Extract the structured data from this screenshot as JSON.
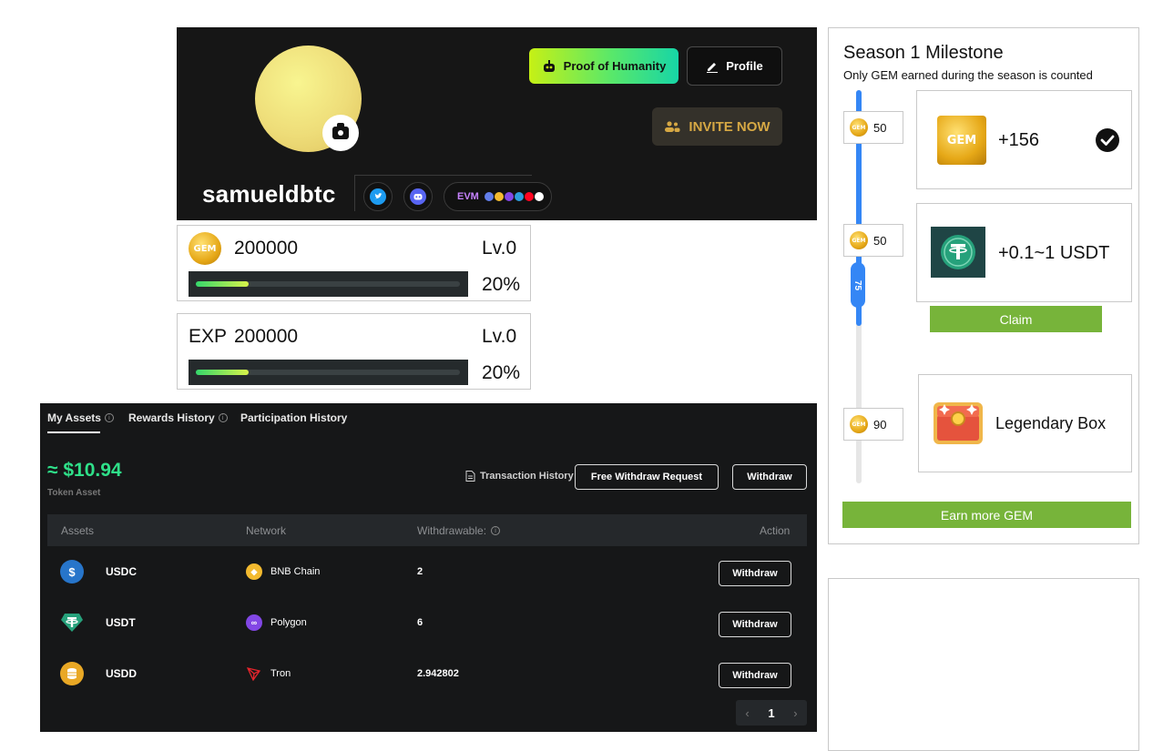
{
  "profile": {
    "username": "samueldbtc",
    "proof_of_humanity_label": "Proof of Humanity",
    "profile_label": "Profile",
    "invite_label": "INVITE NOW",
    "evm_label": "EVM"
  },
  "stats": {
    "gem": {
      "value": "200000",
      "level": "Lv.0",
      "percent_label": "20%",
      "progress": 0.2,
      "coin_label": "GEM"
    },
    "exp": {
      "label": "EXP",
      "value": "200000",
      "level": "Lv.0",
      "percent_label": "20%",
      "progress": 0.2
    }
  },
  "assets": {
    "tabs": [
      {
        "label": "My Assets",
        "active": true
      },
      {
        "label": "Rewards History",
        "active": false
      },
      {
        "label": "Participation History",
        "active": false
      }
    ],
    "total_value": "≈ $10.94",
    "total_caption": "Token Asset",
    "transaction_history_label": "Transaction History",
    "free_withdraw_label": "Free Withdraw Request",
    "withdraw_label": "Withdraw",
    "columns": [
      "Assets",
      "Network",
      "Withdrawable:",
      "Action"
    ],
    "rows": [
      {
        "asset": "USDC",
        "network": "BNB Chain",
        "amount": "2",
        "action": "Withdraw",
        "icon_color": "#2775ca",
        "net_color": "#f3ba2f"
      },
      {
        "asset": "USDT",
        "network": "Polygon",
        "amount": "6",
        "action": "Withdraw",
        "icon_color": "#26a17b",
        "net_color": "#8247e5"
      },
      {
        "asset": "USDD",
        "network": "Tron",
        "amount": "2.942802",
        "action": "Withdraw",
        "icon_color": "#e9a825",
        "net_color": "#e4252c"
      }
    ],
    "pagination": {
      "prev": "‹",
      "current": "1",
      "next": "›"
    }
  },
  "milestone": {
    "title": "Season 1 Milestone",
    "subtitle": "Only GEM earned during the season is counted",
    "progress_badge": "75",
    "progress_fill": 0.6,
    "rewards": [
      {
        "cost": "50",
        "reward": "+156",
        "claimed": true
      },
      {
        "cost": "50",
        "reward": "+0.1~1 USDT",
        "claim_label": "Claim"
      },
      {
        "cost": "90",
        "reward": "Legendary Box"
      }
    ],
    "earn_more_label": "Earn more GEM"
  },
  "colors": {
    "accent_green": "#2fe089",
    "claim_green": "#77b43a",
    "track_blue": "#3486f5",
    "invite_gold": "#d6a844"
  }
}
